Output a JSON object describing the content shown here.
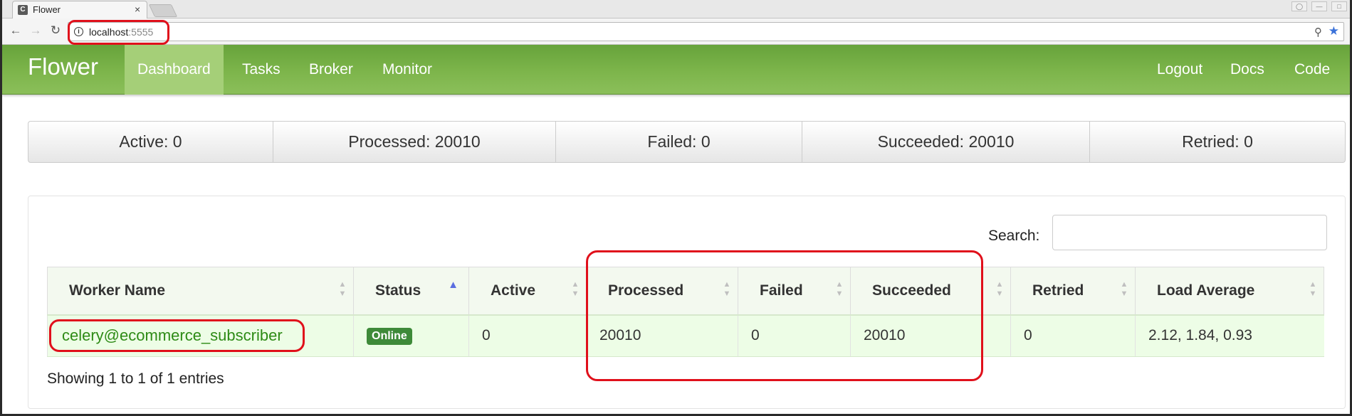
{
  "browser": {
    "tab_title": "Flower",
    "tab_favicon": "C",
    "tab_close": "×",
    "url_host": "localhost",
    "url_port": ":5555",
    "icons": {
      "back": "back-arrow-icon",
      "forward": "forward-arrow-icon",
      "reload": "reload-icon",
      "info": "info-icon",
      "zoom": "zoom-icon",
      "bookmark": "bookmark-star-icon"
    }
  },
  "navbar": {
    "brand": "Flower",
    "links": [
      "Dashboard",
      "Tasks",
      "Broker",
      "Monitor"
    ],
    "active": "Dashboard",
    "right_links": [
      "Logout",
      "Docs",
      "Code"
    ],
    "color": "#7db54b"
  },
  "stats": {
    "active": "Active: 0",
    "processed": "Processed: 20010",
    "failed": "Failed: 0",
    "succeeded": "Succeeded: 20010",
    "retried": "Retried: 0"
  },
  "table": {
    "search_label": "Search:",
    "search_value": "",
    "columns": [
      "Worker Name",
      "Status",
      "Active",
      "Processed",
      "Failed",
      "Succeeded",
      "Retried",
      "Load Average"
    ],
    "sorted_column": "Status",
    "rows": [
      {
        "worker_name": "celery@ecommerce_subscriber",
        "status": "Online",
        "active": "0",
        "processed": "20010",
        "failed": "0",
        "succeeded": "20010",
        "retried": "0",
        "load_average": "2.12, 1.84, 0.93"
      }
    ],
    "footer": "Showing 1 to 1 of 1 entries"
  },
  "colors": {
    "annotation": "#e0101b",
    "row_background": "#edfde6",
    "status_online": "#3e8a39",
    "worker_link": "#2e8b16"
  }
}
